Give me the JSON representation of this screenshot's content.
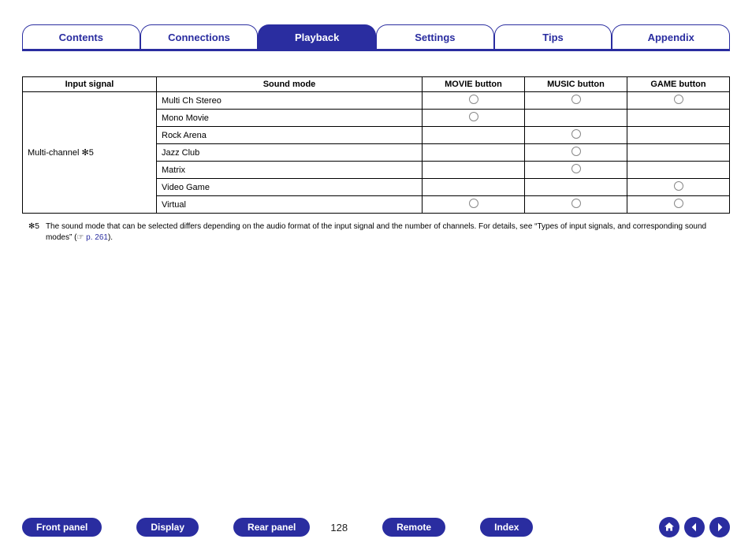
{
  "tabs": {
    "contents": "Contents",
    "connections": "Connections",
    "playback": "Playback",
    "settings": "Settings",
    "tips": "Tips",
    "appendix": "Appendix",
    "active": "playback"
  },
  "table": {
    "headers": {
      "input_signal": "Input signal",
      "sound_mode": "Sound mode",
      "movie": "MOVIE button",
      "music": "MUSIC button",
      "game": "GAME button"
    },
    "input_signal_label": "Multi-channel ✻5",
    "rows": [
      {
        "mode": "Multi Ch Stereo",
        "movie": true,
        "music": true,
        "game": true
      },
      {
        "mode": "Mono Movie",
        "movie": true,
        "music": false,
        "game": false
      },
      {
        "mode": "Rock Arena",
        "movie": false,
        "music": true,
        "game": false
      },
      {
        "mode": "Jazz Club",
        "movie": false,
        "music": true,
        "game": false
      },
      {
        "mode": "Matrix",
        "movie": false,
        "music": true,
        "game": false
      },
      {
        "mode": "Video Game",
        "movie": false,
        "music": false,
        "game": true
      },
      {
        "mode": "Virtual",
        "movie": true,
        "music": true,
        "game": true
      }
    ]
  },
  "footnote": {
    "ref": "✻5",
    "text_before": "The sound mode that can be selected differs depending on the audio format of the input signal and the number of channels. For details, see “Types of input signals, and corresponding sound modes” (☞ ",
    "link_text": "p. 261",
    "text_after": ")."
  },
  "bottom_nav": {
    "front_panel": "Front panel",
    "display": "Display",
    "rear_panel": "Rear panel",
    "remote": "Remote",
    "index": "Index",
    "page": "128"
  }
}
